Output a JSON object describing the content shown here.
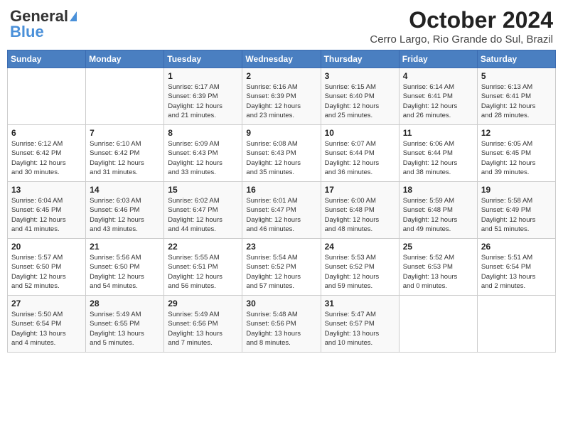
{
  "logo": {
    "line1": "General",
    "line2": "Blue"
  },
  "title": "October 2024",
  "location": "Cerro Largo, Rio Grande do Sul, Brazil",
  "days_of_week": [
    "Sunday",
    "Monday",
    "Tuesday",
    "Wednesday",
    "Thursday",
    "Friday",
    "Saturday"
  ],
  "weeks": [
    [
      {
        "day": "",
        "info": ""
      },
      {
        "day": "",
        "info": ""
      },
      {
        "day": "1",
        "info": "Sunrise: 6:17 AM\nSunset: 6:39 PM\nDaylight: 12 hours\nand 21 minutes."
      },
      {
        "day": "2",
        "info": "Sunrise: 6:16 AM\nSunset: 6:39 PM\nDaylight: 12 hours\nand 23 minutes."
      },
      {
        "day": "3",
        "info": "Sunrise: 6:15 AM\nSunset: 6:40 PM\nDaylight: 12 hours\nand 25 minutes."
      },
      {
        "day": "4",
        "info": "Sunrise: 6:14 AM\nSunset: 6:41 PM\nDaylight: 12 hours\nand 26 minutes."
      },
      {
        "day": "5",
        "info": "Sunrise: 6:13 AM\nSunset: 6:41 PM\nDaylight: 12 hours\nand 28 minutes."
      }
    ],
    [
      {
        "day": "6",
        "info": "Sunrise: 6:12 AM\nSunset: 6:42 PM\nDaylight: 12 hours\nand 30 minutes."
      },
      {
        "day": "7",
        "info": "Sunrise: 6:10 AM\nSunset: 6:42 PM\nDaylight: 12 hours\nand 31 minutes."
      },
      {
        "day": "8",
        "info": "Sunrise: 6:09 AM\nSunset: 6:43 PM\nDaylight: 12 hours\nand 33 minutes."
      },
      {
        "day": "9",
        "info": "Sunrise: 6:08 AM\nSunset: 6:43 PM\nDaylight: 12 hours\nand 35 minutes."
      },
      {
        "day": "10",
        "info": "Sunrise: 6:07 AM\nSunset: 6:44 PM\nDaylight: 12 hours\nand 36 minutes."
      },
      {
        "day": "11",
        "info": "Sunrise: 6:06 AM\nSunset: 6:44 PM\nDaylight: 12 hours\nand 38 minutes."
      },
      {
        "day": "12",
        "info": "Sunrise: 6:05 AM\nSunset: 6:45 PM\nDaylight: 12 hours\nand 39 minutes."
      }
    ],
    [
      {
        "day": "13",
        "info": "Sunrise: 6:04 AM\nSunset: 6:45 PM\nDaylight: 12 hours\nand 41 minutes."
      },
      {
        "day": "14",
        "info": "Sunrise: 6:03 AM\nSunset: 6:46 PM\nDaylight: 12 hours\nand 43 minutes."
      },
      {
        "day": "15",
        "info": "Sunrise: 6:02 AM\nSunset: 6:47 PM\nDaylight: 12 hours\nand 44 minutes."
      },
      {
        "day": "16",
        "info": "Sunrise: 6:01 AM\nSunset: 6:47 PM\nDaylight: 12 hours\nand 46 minutes."
      },
      {
        "day": "17",
        "info": "Sunrise: 6:00 AM\nSunset: 6:48 PM\nDaylight: 12 hours\nand 48 minutes."
      },
      {
        "day": "18",
        "info": "Sunrise: 5:59 AM\nSunset: 6:48 PM\nDaylight: 12 hours\nand 49 minutes."
      },
      {
        "day": "19",
        "info": "Sunrise: 5:58 AM\nSunset: 6:49 PM\nDaylight: 12 hours\nand 51 minutes."
      }
    ],
    [
      {
        "day": "20",
        "info": "Sunrise: 5:57 AM\nSunset: 6:50 PM\nDaylight: 12 hours\nand 52 minutes."
      },
      {
        "day": "21",
        "info": "Sunrise: 5:56 AM\nSunset: 6:50 PM\nDaylight: 12 hours\nand 54 minutes."
      },
      {
        "day": "22",
        "info": "Sunrise: 5:55 AM\nSunset: 6:51 PM\nDaylight: 12 hours\nand 56 minutes."
      },
      {
        "day": "23",
        "info": "Sunrise: 5:54 AM\nSunset: 6:52 PM\nDaylight: 12 hours\nand 57 minutes."
      },
      {
        "day": "24",
        "info": "Sunrise: 5:53 AM\nSunset: 6:52 PM\nDaylight: 12 hours\nand 59 minutes."
      },
      {
        "day": "25",
        "info": "Sunrise: 5:52 AM\nSunset: 6:53 PM\nDaylight: 13 hours\nand 0 minutes."
      },
      {
        "day": "26",
        "info": "Sunrise: 5:51 AM\nSunset: 6:54 PM\nDaylight: 13 hours\nand 2 minutes."
      }
    ],
    [
      {
        "day": "27",
        "info": "Sunrise: 5:50 AM\nSunset: 6:54 PM\nDaylight: 13 hours\nand 4 minutes."
      },
      {
        "day": "28",
        "info": "Sunrise: 5:49 AM\nSunset: 6:55 PM\nDaylight: 13 hours\nand 5 minutes."
      },
      {
        "day": "29",
        "info": "Sunrise: 5:49 AM\nSunset: 6:56 PM\nDaylight: 13 hours\nand 7 minutes."
      },
      {
        "day": "30",
        "info": "Sunrise: 5:48 AM\nSunset: 6:56 PM\nDaylight: 13 hours\nand 8 minutes."
      },
      {
        "day": "31",
        "info": "Sunrise: 5:47 AM\nSunset: 6:57 PM\nDaylight: 13 hours\nand 10 minutes."
      },
      {
        "day": "",
        "info": ""
      },
      {
        "day": "",
        "info": ""
      }
    ]
  ]
}
